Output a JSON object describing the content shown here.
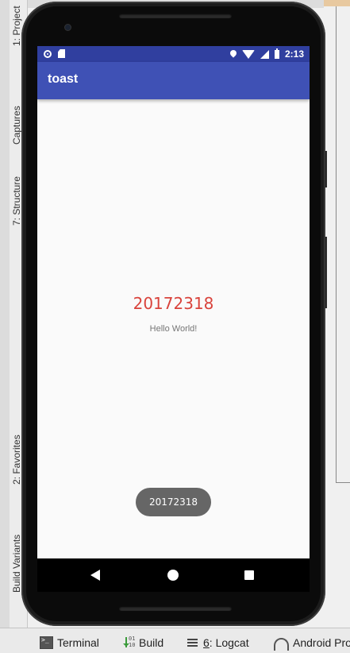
{
  "ide": {
    "side_tabs": {
      "project": "1: Project",
      "captures": "Captures",
      "structure": "7: Structure",
      "favorites": "2: Favorites",
      "build_variants": "Build Variants"
    },
    "bottom_tabs": {
      "terminal": "Terminal",
      "build": "Build",
      "logcat_num": "6",
      "logcat_text": ": Logcat",
      "profiler": "Android Pro"
    }
  },
  "device": {
    "status_bar": {
      "time": "2:13",
      "icons": [
        "notification-dot-icon",
        "sd-card-icon",
        "location-icon",
        "wifi-icon",
        "signal-icon",
        "battery-icon"
      ]
    },
    "app": {
      "title": "toast",
      "number_text": "20172318",
      "hello_text": "Hello World!"
    },
    "toast": {
      "text": "20172318"
    },
    "nav_bar": [
      "back-icon",
      "home-icon",
      "recents-icon"
    ]
  },
  "colors": {
    "status_bar": "#303f9f",
    "toolbar": "#3f51b5",
    "number_text": "#d9433c",
    "toast_bg": "#666666"
  }
}
